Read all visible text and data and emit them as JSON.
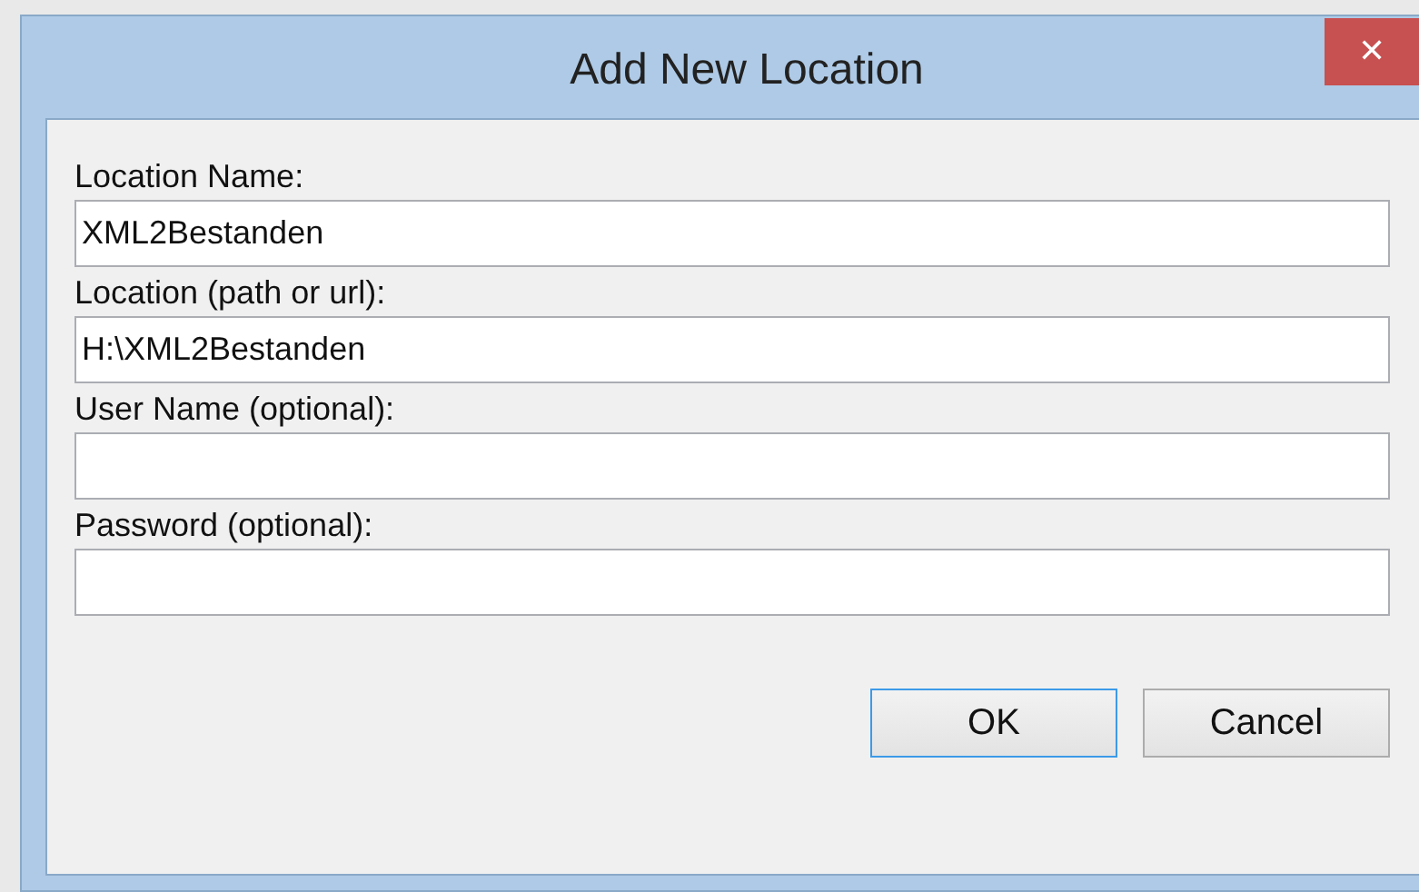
{
  "window": {
    "title": "Add New Location",
    "close": "✕"
  },
  "fields": [
    {
      "label": "Location Name:",
      "value": "XML2Bestanden"
    },
    {
      "label": "Location (path or url):",
      "value": "H:\\XML2Bestanden"
    },
    {
      "label": "User Name (optional):"
    },
    {
      "label": "Password (optional):"
    }
  ],
  "buttons": [
    {
      "label": "OK",
      "focused": true
    },
    {
      "label": "Cancel",
      "focused": false
    }
  ]
}
